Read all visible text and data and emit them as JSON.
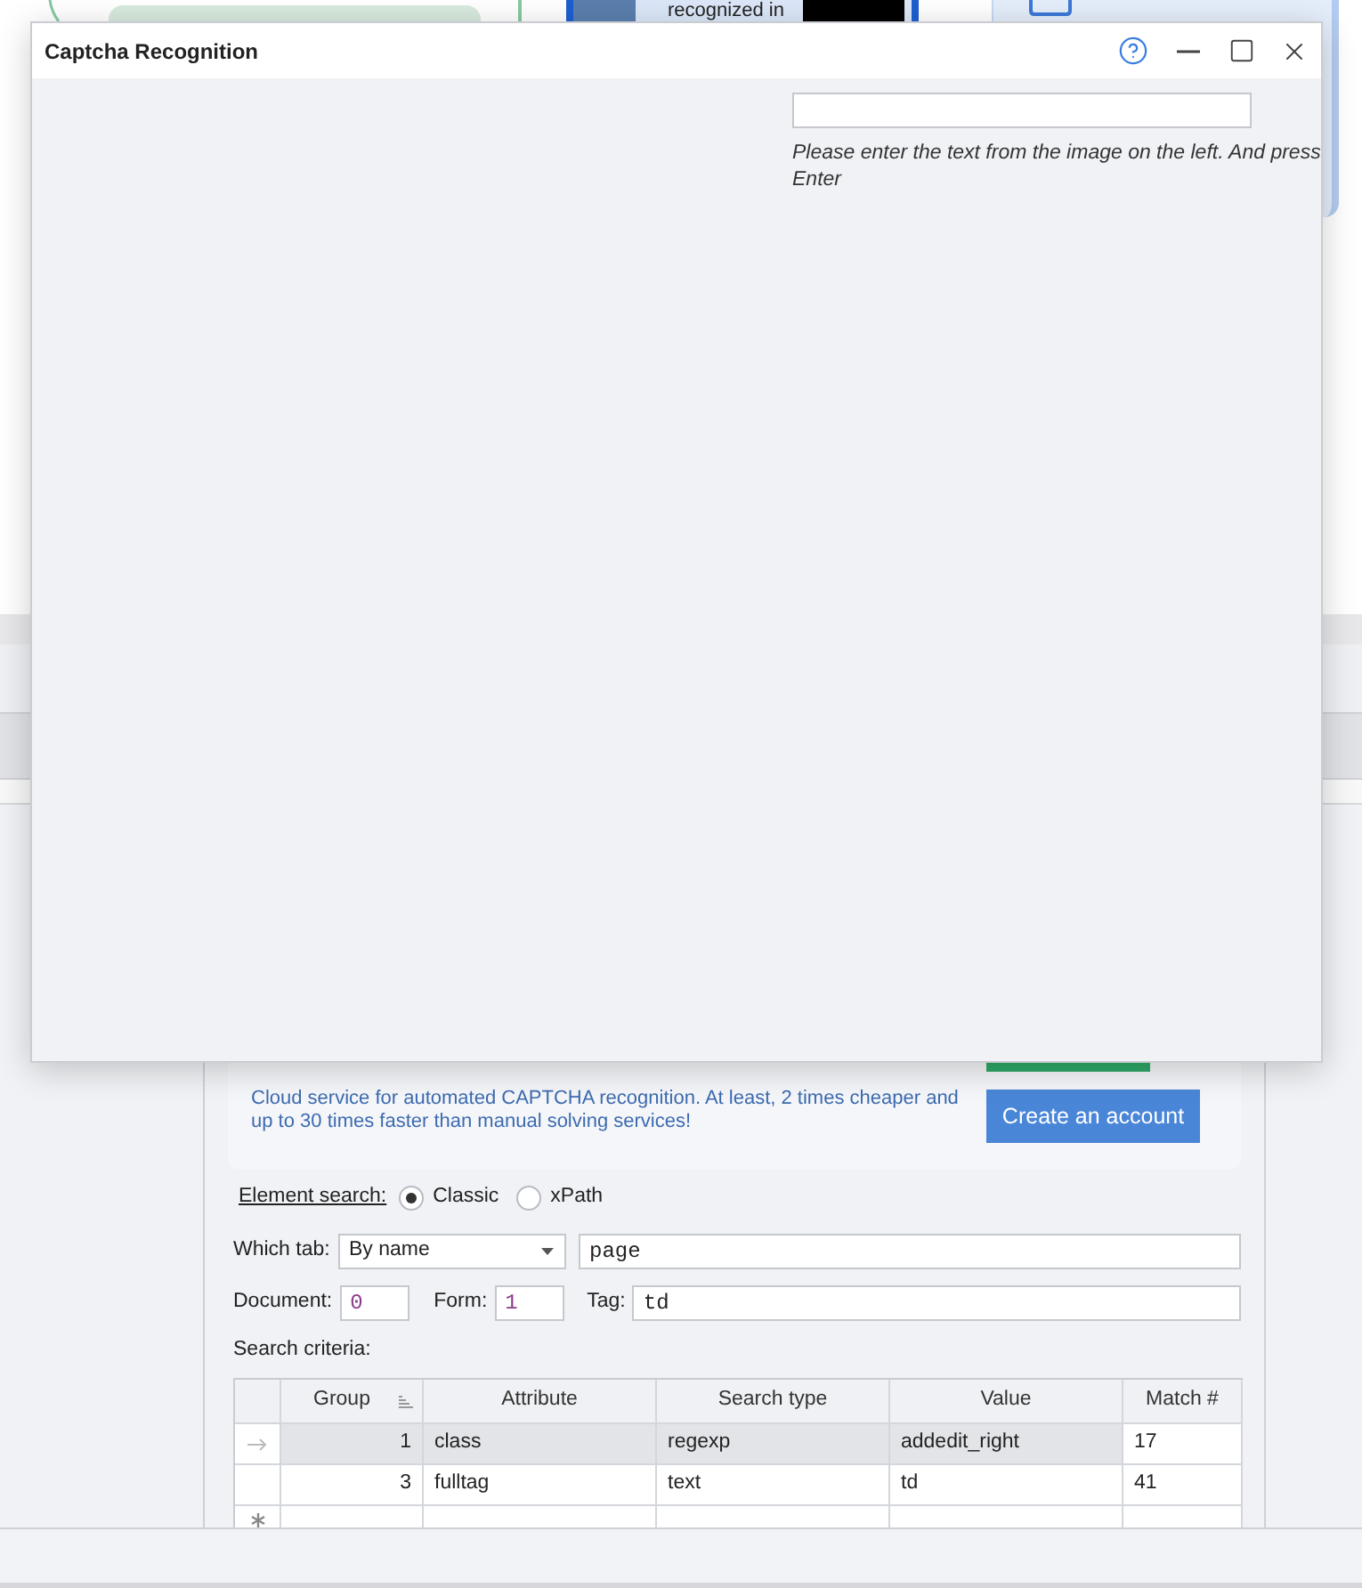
{
  "canvas": {
    "recognition_node": {
      "caption": "recognized in"
    }
  },
  "dialog": {
    "title": "Captcha Recognition",
    "hint": "Please enter the text from the image on the left. And press Enter"
  },
  "service_card": {
    "description": "Cloud service for automated CAPTCHA recognition. At least, 2 times cheaper and up to 30 times faster than manual solving services!",
    "button": "Create an account"
  },
  "element_search": {
    "label": "Element search:",
    "options": [
      {
        "label": "Classic",
        "selected": true
      },
      {
        "label": "xPath",
        "selected": false
      }
    ]
  },
  "which_tab": {
    "label": "Which tab:",
    "dropdown": "By name",
    "value": "page"
  },
  "document": {
    "label": "Document:",
    "value": "0"
  },
  "form": {
    "label": "Form:",
    "value": "1"
  },
  "tag": {
    "label": "Tag:",
    "value": "td"
  },
  "search_criteria": {
    "label": "Search criteria:",
    "columns": [
      {
        "label": "Group",
        "sorted": true
      },
      {
        "label": "Attribute",
        "sorted": false
      },
      {
        "label": "Search type",
        "sorted": false
      },
      {
        "label": "Value",
        "sorted": false
      },
      {
        "label": "Match #",
        "sorted": false
      }
    ],
    "rows": [
      {
        "kind": "data",
        "selected": true,
        "cells": [
          {
            "text": "1",
            "focused": false
          },
          {
            "text": "class",
            "focused": false
          },
          {
            "text": "regexp",
            "focused": false
          },
          {
            "text": "addedit_right",
            "focused": false
          },
          {
            "text": "17",
            "focused": true
          }
        ]
      },
      {
        "kind": "data",
        "selected": false,
        "cells": [
          {
            "text": "3",
            "focused": false
          },
          {
            "text": "fulltag",
            "focused": false
          },
          {
            "text": "text",
            "focused": false
          },
          {
            "text": "td",
            "focused": false
          },
          {
            "text": "41",
            "focused": false
          }
        ]
      },
      {
        "kind": "new",
        "selected": false
      }
    ]
  }
}
